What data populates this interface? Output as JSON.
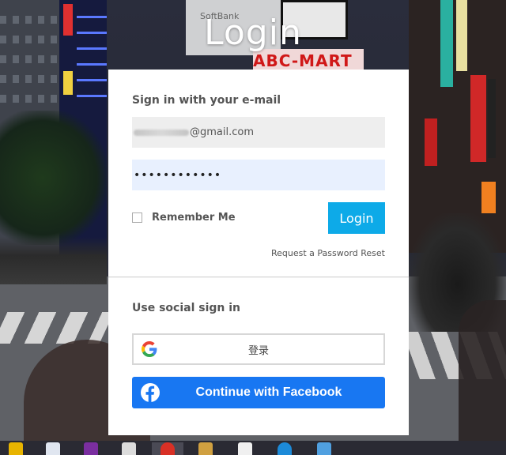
{
  "page": {
    "title": "Login"
  },
  "email_section": {
    "heading": "Sign in with your e-mail",
    "email_visible_suffix": "@gmail.com",
    "password_masked": "••••••••••••"
  },
  "remember": {
    "label": "Remember Me",
    "checked": false
  },
  "login_button": {
    "label": "Login",
    "color": "#0daae8"
  },
  "reset_link": {
    "label": "Request a Password Reset"
  },
  "social_section": {
    "heading": "Use social sign in"
  },
  "google_button": {
    "label": "登录",
    "icon": "google-g-icon"
  },
  "facebook_button": {
    "label": "Continue with Facebook",
    "icon": "facebook-icon",
    "color": "#1877f2"
  },
  "background_signs": {
    "sign_a": "ABC-MART",
    "sign_b": "SoftBank"
  },
  "taskbar": {
    "items": [
      {
        "icon": "file-explorer-icon",
        "color": "#e8b400"
      },
      {
        "icon": "maps-icon",
        "color": "#e0e6f0"
      },
      {
        "icon": "onenote-icon",
        "color": "#7a2ea0"
      },
      {
        "icon": "notepad-icon",
        "color": "#dcdcdc"
      },
      {
        "icon": "chrome-icon",
        "color": "#d93025",
        "active": true
      },
      {
        "icon": "paint-icon",
        "color": "#d0a040"
      },
      {
        "icon": "notes-icon",
        "color": "#f0f0f0"
      },
      {
        "icon": "k-app-icon",
        "color": "#1c8ad8"
      },
      {
        "icon": "tools-icon",
        "color": "#50a0e0"
      }
    ]
  }
}
